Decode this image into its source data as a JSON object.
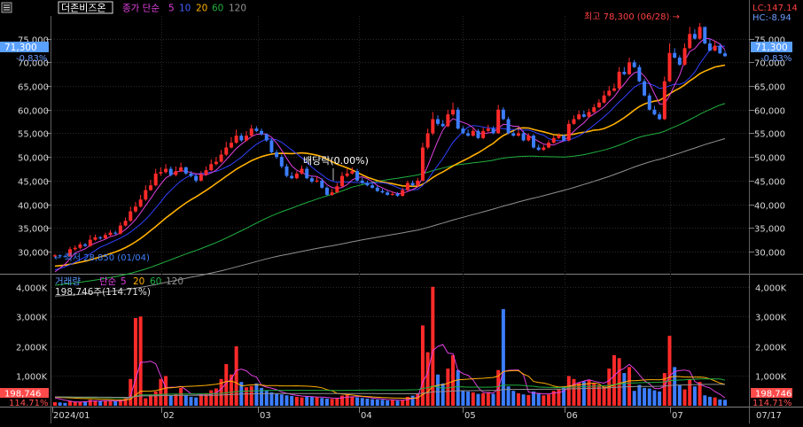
{
  "header": {
    "title": "더존비즈온",
    "ma_label": "종가 단순",
    "ma_periods": [
      "5",
      "10",
      "20",
      "60",
      "120"
    ],
    "right_info": [
      "LC:147.14",
      "HC:-8.94"
    ]
  },
  "price_badge": {
    "value": "71,300",
    "change": "-0.83%"
  },
  "annotations": {
    "high": "최고 78,300 (06/28) →",
    "low": "← 최저 28,850 (01/04)",
    "dividend": "배당락(0.00%)"
  },
  "volume_header": {
    "title": "거래량",
    "ma_label": "단순",
    "ma_periods": [
      "5",
      "20",
      "60",
      "120"
    ],
    "current": "198,746주(114.71%)"
  },
  "volume_badge": {
    "value": "198,746",
    "change": "114.71%"
  },
  "x_axis": {
    "labels": [
      "2024/01",
      "02",
      "03",
      "04",
      "05",
      "06",
      "07"
    ],
    "right_label": "07/17"
  },
  "colors": {
    "up": "#ff2a2a",
    "down": "#3c7dff",
    "ma5": "#e040e0",
    "ma10": "#3040ff",
    "ma20": "#ffb000",
    "ma60": "#20b040",
    "ma120": "#909090"
  },
  "chart_data": [
    {
      "type": "candlestick",
      "title": "더존비즈온",
      "x": [
        "2024-01-02",
        "2024-01-03",
        "2024-01-04",
        "2024-01-05",
        "2024-01-08",
        "2024-01-09",
        "2024-01-10",
        "2024-01-11",
        "2024-01-12",
        "2024-01-15",
        "2024-01-16",
        "2024-01-17",
        "2024-01-18",
        "2024-01-19",
        "2024-01-22",
        "2024-01-23",
        "2024-01-24",
        "2024-01-25",
        "2024-01-26",
        "2024-01-29",
        "2024-01-30",
        "2024-01-31",
        "2024-02-01",
        "2024-02-02",
        "2024-02-05",
        "2024-02-06",
        "2024-02-07",
        "2024-02-08",
        "2024-02-13",
        "2024-02-14",
        "2024-02-15",
        "2024-02-16",
        "2024-02-19",
        "2024-02-20",
        "2024-02-21",
        "2024-02-22",
        "2024-02-23",
        "2024-02-26",
        "2024-02-27",
        "2024-02-28",
        "2024-02-29",
        "2024-03-04",
        "2024-03-05",
        "2024-03-06",
        "2024-03-07",
        "2024-03-08",
        "2024-03-11",
        "2024-03-12",
        "2024-03-13",
        "2024-03-14",
        "2024-03-15",
        "2024-03-18",
        "2024-03-19",
        "2024-03-20",
        "2024-03-21",
        "2024-03-22",
        "2024-03-25",
        "2024-03-26",
        "2024-03-27",
        "2024-03-28",
        "2024-03-29",
        "2024-04-01",
        "2024-04-02",
        "2024-04-03",
        "2024-04-04",
        "2024-04-05",
        "2024-04-08",
        "2024-04-09",
        "2024-04-11",
        "2024-04-12",
        "2024-04-15",
        "2024-04-16",
        "2024-04-17",
        "2024-04-18",
        "2024-04-19",
        "2024-04-22",
        "2024-04-23",
        "2024-04-24",
        "2024-04-25",
        "2024-04-26",
        "2024-04-29",
        "2024-04-30",
        "2024-05-02",
        "2024-05-03",
        "2024-05-07",
        "2024-05-08",
        "2024-05-09",
        "2024-05-10",
        "2024-05-13",
        "2024-05-14",
        "2024-05-16",
        "2024-05-17",
        "2024-05-20",
        "2024-05-21",
        "2024-05-22",
        "2024-05-23",
        "2024-05-24",
        "2024-05-27",
        "2024-05-28",
        "2024-05-29",
        "2024-05-30",
        "2024-05-31",
        "2024-06-03",
        "2024-06-04",
        "2024-06-05",
        "2024-06-07",
        "2024-06-10",
        "2024-06-11",
        "2024-06-12",
        "2024-06-13",
        "2024-06-14",
        "2024-06-17",
        "2024-06-18",
        "2024-06-19",
        "2024-06-20",
        "2024-06-21",
        "2024-06-24",
        "2024-06-25",
        "2024-06-26",
        "2024-06-27",
        "2024-06-28",
        "2024-07-01",
        "2024-07-02",
        "2024-07-03",
        "2024-07-04",
        "2024-07-05",
        "2024-07-08",
        "2024-07-09",
        "2024-07-10",
        "2024-07-11",
        "2024-07-12",
        "2024-07-15",
        "2024-07-16",
        "2024-07-17"
      ],
      "close": [
        29200,
        29000,
        28900,
        30500,
        30800,
        31500,
        31200,
        32500,
        33000,
        32800,
        33500,
        34000,
        33800,
        35500,
        36500,
        38500,
        39500,
        41000,
        43000,
        44000,
        46500,
        46800,
        47500,
        46200,
        47000,
        47800,
        46500,
        46000,
        45000,
        46300,
        47200,
        48500,
        49000,
        50500,
        52000,
        53000,
        54500,
        53500,
        54500,
        56000,
        55500,
        54800,
        53500,
        51000,
        50000,
        48000,
        46000,
        45500,
        46500,
        47500,
        45500,
        44800,
        45000,
        43500,
        42000,
        42500,
        43800,
        46000,
        46500,
        47000,
        45000,
        44500,
        44000,
        43500,
        42800,
        42500,
        42000,
        42200,
        41800,
        43000,
        44500,
        44000,
        45000,
        52000,
        55000,
        58000,
        57000,
        56500,
        59000,
        60000,
        56000,
        55000,
        54500,
        55500,
        54000,
        55500,
        56000,
        55000,
        60000,
        58000,
        55000,
        54500,
        55000,
        53500,
        54500,
        52000,
        51500,
        52000,
        53000,
        54000,
        54500,
        53500,
        57000,
        58000,
        59000,
        58500,
        59500,
        60500,
        61500,
        63000,
        64000,
        64500,
        68000,
        67500,
        70000,
        69000,
        66000,
        63000,
        60000,
        59000,
        58000,
        66000,
        72000,
        71000,
        69500,
        73000,
        76000,
        75000,
        77500,
        74000,
        72500,
        73500,
        71900,
        71300
      ],
      "open": [
        28950,
        29200,
        29000,
        29000,
        30500,
        30800,
        31500,
        31200,
        32500,
        33000,
        32800,
        33500,
        34000,
        33800,
        35500,
        36500,
        38500,
        39500,
        41000,
        43000,
        44000,
        46500,
        46800,
        47500,
        46200,
        47000,
        47800,
        46500,
        46000,
        45000,
        46300,
        47200,
        48500,
        49000,
        50500,
        52000,
        53000,
        54500,
        53500,
        54500,
        56000,
        55500,
        54800,
        53500,
        51000,
        50000,
        48000,
        46000,
        45500,
        46500,
        47500,
        45500,
        44800,
        45000,
        43500,
        42000,
        42500,
        43800,
        46000,
        46500,
        47000,
        45000,
        44500,
        44000,
        43500,
        42800,
        42500,
        42000,
        42200,
        41800,
        43000,
        44500,
        44000,
        45000,
        52000,
        55000,
        58000,
        57000,
        56500,
        59000,
        60000,
        56000,
        55000,
        54500,
        55500,
        54000,
        55500,
        56000,
        55000,
        60000,
        58000,
        55000,
        54500,
        55000,
        53500,
        54500,
        52000,
        51500,
        52000,
        53000,
        54000,
        54500,
        53500,
        57000,
        58000,
        59000,
        58500,
        59500,
        60500,
        61500,
        63000,
        64000,
        64500,
        68000,
        67500,
        70000,
        69000,
        66000,
        63000,
        60000,
        59000,
        58000,
        66000,
        72000,
        71000,
        69500,
        73000,
        76000,
        75000,
        77500,
        74000,
        72500,
        73500,
        71900
      ],
      "high": [
        29500,
        29400,
        29300,
        31000,
        31300,
        32000,
        31800,
        33500,
        33600,
        33300,
        34000,
        34500,
        34400,
        36200,
        37200,
        39500,
        40500,
        42000,
        44000,
        45200,
        47500,
        47800,
        48500,
        48000,
        48000,
        48800,
        48000,
        47000,
        46300,
        47000,
        48000,
        49500,
        50000,
        51500,
        53200,
        54200,
        55800,
        55000,
        55500,
        56800,
        56500,
        56000,
        55000,
        53800,
        51500,
        50500,
        48500,
        46800,
        47000,
        48200,
        48000,
        46000,
        45800,
        45500,
        43800,
        43200,
        44500,
        46800,
        47500,
        47800,
        47500,
        45600,
        45000,
        44500,
        43900,
        43300,
        42900,
        42700,
        42600,
        43500,
        45000,
        45000,
        45600,
        53000,
        56000,
        59500,
        58800,
        57800,
        60000,
        61500,
        60500,
        56500,
        55800,
        56000,
        55900,
        56200,
        56800,
        56500,
        61000,
        60500,
        58500,
        55500,
        55800,
        55500,
        55000,
        54800,
        52600,
        52500,
        53500,
        54500,
        55000,
        54800,
        57800,
        58800,
        59800,
        59800,
        60200,
        61200,
        62200,
        64000,
        65000,
        65500,
        69000,
        69000,
        71000,
        70500,
        69500,
        66500,
        63500,
        60800,
        59500,
        67000,
        74000,
        73000,
        71500,
        74000,
        77500,
        77000,
        78300,
        77500,
        75000,
        74500,
        74000,
        72500
      ],
      "low": [
        28850,
        28850,
        28850,
        28950,
        30200,
        30500,
        31000,
        31000,
        32300,
        32500,
        32600,
        33300,
        33500,
        33600,
        35300,
        36300,
        38200,
        39300,
        40700,
        42800,
        43800,
        46000,
        46500,
        45900,
        45900,
        46800,
        46200,
        45700,
        44600,
        44800,
        46000,
        47000,
        48200,
        48800,
        50200,
        51800,
        52800,
        53200,
        53300,
        54200,
        55300,
        54500,
        53200,
        50800,
        49600,
        47600,
        45700,
        45300,
        45300,
        46300,
        45300,
        44500,
        44600,
        43300,
        41800,
        41800,
        42400,
        43600,
        45700,
        46300,
        44800,
        44300,
        43800,
        43300,
        42600,
        42300,
        41800,
        41800,
        41600,
        41600,
        42800,
        43800,
        43800,
        44800,
        51600,
        54600,
        56600,
        56300,
        56300,
        58600,
        55800,
        54800,
        54300,
        54300,
        53800,
        53800,
        55300,
        54800,
        54900,
        57800,
        54800,
        54300,
        54300,
        53300,
        53300,
        51800,
        51300,
        51300,
        51800,
        52800,
        53800,
        53300,
        53300,
        56800,
        57800,
        58300,
        58300,
        59300,
        60300,
        61300,
        62800,
        63800,
        64300,
        67300,
        67300,
        68800,
        65800,
        62800,
        59800,
        58800,
        57800,
        57800,
        65800,
        70800,
        69300,
        69300,
        72800,
        74800,
        74800,
        73800,
        72300,
        72300,
        71800,
        71200
      ],
      "volume": [
        120000,
        110000,
        95000,
        160000,
        140000,
        130000,
        150000,
        200000,
        180000,
        150000,
        170000,
        160000,
        150000,
        190000,
        250000,
        900000,
        2950000,
        3000000,
        250000,
        380000,
        480000,
        900000,
        1000000,
        350000,
        400000,
        600000,
        350000,
        300000,
        280000,
        380000,
        420000,
        520000,
        580000,
        900000,
        1400000,
        1050000,
        2000000,
        800000,
        620000,
        660000,
        750000,
        600000,
        500000,
        450000,
        400000,
        380000,
        350000,
        330000,
        300000,
        280000,
        320000,
        300000,
        280000,
        260000,
        240000,
        230000,
        260000,
        340000,
        370000,
        300000,
        280000,
        260000,
        240000,
        220000,
        210000,
        200000,
        180000,
        190000,
        170000,
        200000,
        300000,
        340000,
        420000,
        2700000,
        1800000,
        4000000,
        1050000,
        750000,
        1250000,
        1700000,
        1200000,
        500000,
        480000,
        450000,
        400000,
        420000,
        460000,
        400000,
        1200000,
        3250000,
        650000,
        500000,
        420000,
        380000,
        360000,
        480000,
        430000,
        350000,
        380000,
        500000,
        560000,
        650000,
        1000000,
        900000,
        780000,
        820000,
        880000,
        750000,
        700000,
        650000,
        1250000,
        1700000,
        1600000,
        1100000,
        1300000,
        500000,
        700000,
        600000,
        580000,
        520000,
        480000,
        1100000,
        2350000,
        1300000,
        700000,
        550000,
        900000,
        650000,
        800000,
        350000,
        300000,
        280000,
        210000,
        198746
      ],
      "ylim": [
        27000,
        78500
      ],
      "ma_periods": [
        5,
        10,
        20,
        60,
        120
      ],
      "ma_colors": [
        "#e040e0",
        "#3040ff",
        "#ffb000",
        "#20b040",
        "#909090"
      ],
      "ma_seeds": [
        24800,
        25800,
        26800,
        22800,
        20500
      ],
      "y_ticks": [
        "30,000",
        "35,000",
        "40,000",
        "45,000",
        "50,000",
        "55,000",
        "60,000",
        "65,000",
        "70,000",
        "75,000"
      ],
      "vol_ticks": [
        "1,000K",
        "2,000K",
        "3,000K",
        "4,000K"
      ],
      "vol_ylim": [
        0,
        4350000
      ],
      "grid": true
    }
  ]
}
